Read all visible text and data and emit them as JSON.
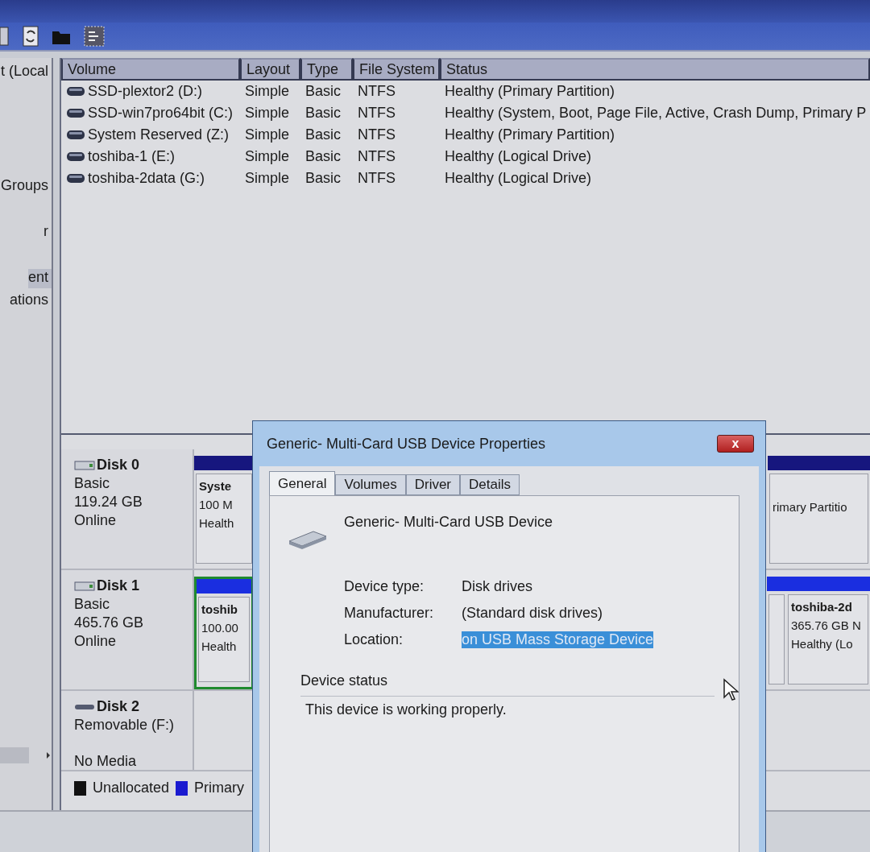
{
  "toolbar": {
    "kind": "icons"
  },
  "tree": {
    "items": [
      {
        "label": "t (Local",
        "selected": false
      },
      {
        "label": "Groups",
        "selected": false
      },
      {
        "label": "r",
        "selected": false
      },
      {
        "label": "ent",
        "selected": true
      },
      {
        "label": "ations",
        "selected": false
      }
    ]
  },
  "table": {
    "columns": [
      "Volume",
      "Layout",
      "Type",
      "File System",
      "Status"
    ],
    "rows": [
      {
        "cells": [
          "SSD-plextor2 (D:)",
          "Simple",
          "Basic",
          "NTFS",
          "Healthy (Primary Partition)"
        ]
      },
      {
        "cells": [
          "SSD-win7pro64bit (C:)",
          "Simple",
          "Basic",
          "NTFS",
          "Healthy (System, Boot, Page File, Active, Crash Dump, Primary P"
        ]
      },
      {
        "cells": [
          "System Reserved (Z:)",
          "Simple",
          "Basic",
          "NTFS",
          "Healthy (Primary Partition)"
        ]
      },
      {
        "cells": [
          "toshiba-1 (E:)",
          "Simple",
          "Basic",
          "NTFS",
          "Healthy (Logical Drive)"
        ]
      },
      {
        "cells": [
          "toshiba-2data (G:)",
          "Simple",
          "Basic",
          "NTFS",
          "Healthy (Logical Drive)"
        ]
      }
    ]
  },
  "disks": [
    {
      "kind": "fixed",
      "name": "Disk 0",
      "lines": [
        "Basic",
        "119.24 GB",
        "Online"
      ],
      "left": {
        "color": "#16167e",
        "selected": false,
        "lines": [
          "Syste",
          "100 M",
          "Health"
        ]
      },
      "right": [
        {
          "color": "#16167e",
          "selected": false,
          "lines": [
            "rimary Partitio"
          ]
        }
      ]
    },
    {
      "kind": "fixed",
      "name": "Disk 1",
      "lines": [
        "Basic",
        "465.76 GB",
        "Online"
      ],
      "left": {
        "color": "#1a2ee0",
        "selected": true,
        "lines": [
          "toshib",
          "100.00",
          "Health"
        ]
      },
      "right": [
        {
          "color": "#1a2ee0",
          "selected": false
        },
        {
          "color": "#1a2ee0",
          "selected": false,
          "lines": [
            "toshiba-2d",
            "365.76 GB N",
            "Healthy (Lo"
          ]
        }
      ]
    },
    {
      "kind": "removable",
      "name": "Disk 2",
      "lines": [
        "Removable (F:)",
        "No Media"
      ]
    }
  ],
  "legend": [
    {
      "label": "Unallocated",
      "color": "#111111"
    },
    {
      "label": "Primary",
      "color": "#1a1ad0"
    }
  ],
  "dialog": {
    "title": "Generic- Multi-Card USB Device Properties",
    "close": "x",
    "tabs": [
      {
        "label": "General",
        "selected": true
      },
      {
        "label": "Volumes",
        "selected": false
      },
      {
        "label": "Driver",
        "selected": false
      },
      {
        "label": "Details",
        "selected": false
      }
    ],
    "device_name": "Generic- Multi-Card USB Device",
    "properties": [
      {
        "label": "Device type:",
        "value": "Disk drives",
        "highlighted": false
      },
      {
        "label": "Manufacturer:",
        "value": "(Standard disk drives)",
        "highlighted": false
      },
      {
        "label": "Location:",
        "value": "on USB Mass Storage Device",
        "highlighted": true
      }
    ],
    "status_group": "Device status",
    "status_text": "This device is working properly."
  }
}
